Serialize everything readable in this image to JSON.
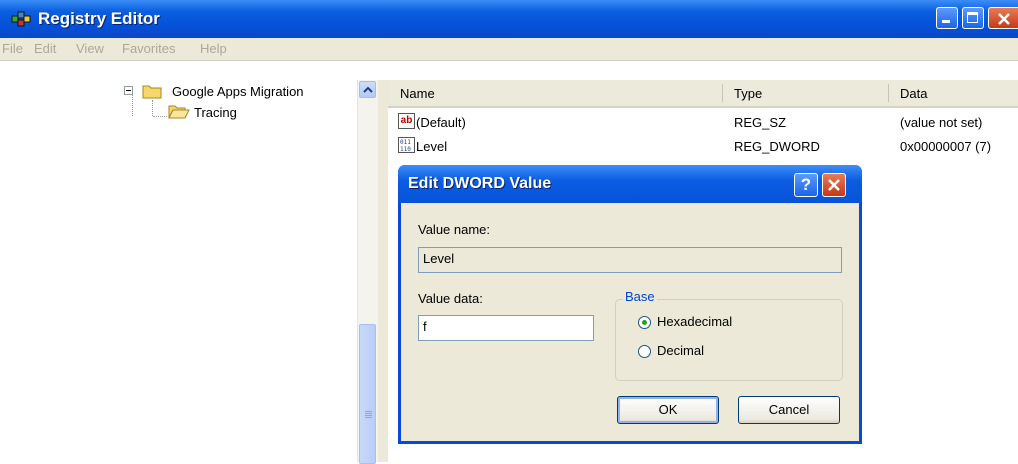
{
  "window": {
    "title": "Registry Editor"
  },
  "menu": [
    "File",
    "Edit",
    "View",
    "Favorites",
    "Help"
  ],
  "tree": {
    "items": [
      {
        "label": "Google Apps Migration",
        "expanded": true
      },
      {
        "label": "Tracing",
        "selected": false
      }
    ]
  },
  "list": {
    "columns": [
      "Name",
      "Type",
      "Data"
    ],
    "rows": [
      {
        "icon": "string-value-icon",
        "name": "(Default)",
        "type": "REG_SZ",
        "data": "(value not set)"
      },
      {
        "icon": "binary-value-icon",
        "name": "Level",
        "type": "REG_DWORD",
        "data": "0x00000007 (7)"
      }
    ]
  },
  "dialog": {
    "title": "Edit DWORD Value",
    "value_name_label": "Value name:",
    "value_name": "Level",
    "value_data_label": "Value data:",
    "value_data": "f",
    "base_label": "Base",
    "base_options": [
      {
        "label": "Hexadecimal",
        "selected": true
      },
      {
        "label": "Decimal",
        "selected": false
      }
    ],
    "ok_label": "OK",
    "cancel_label": "Cancel",
    "help_label": "?"
  },
  "colors": {
    "title_bar": "#0550d8",
    "dialog_body": "#ece9d8",
    "group_legend": "#0046d5"
  }
}
